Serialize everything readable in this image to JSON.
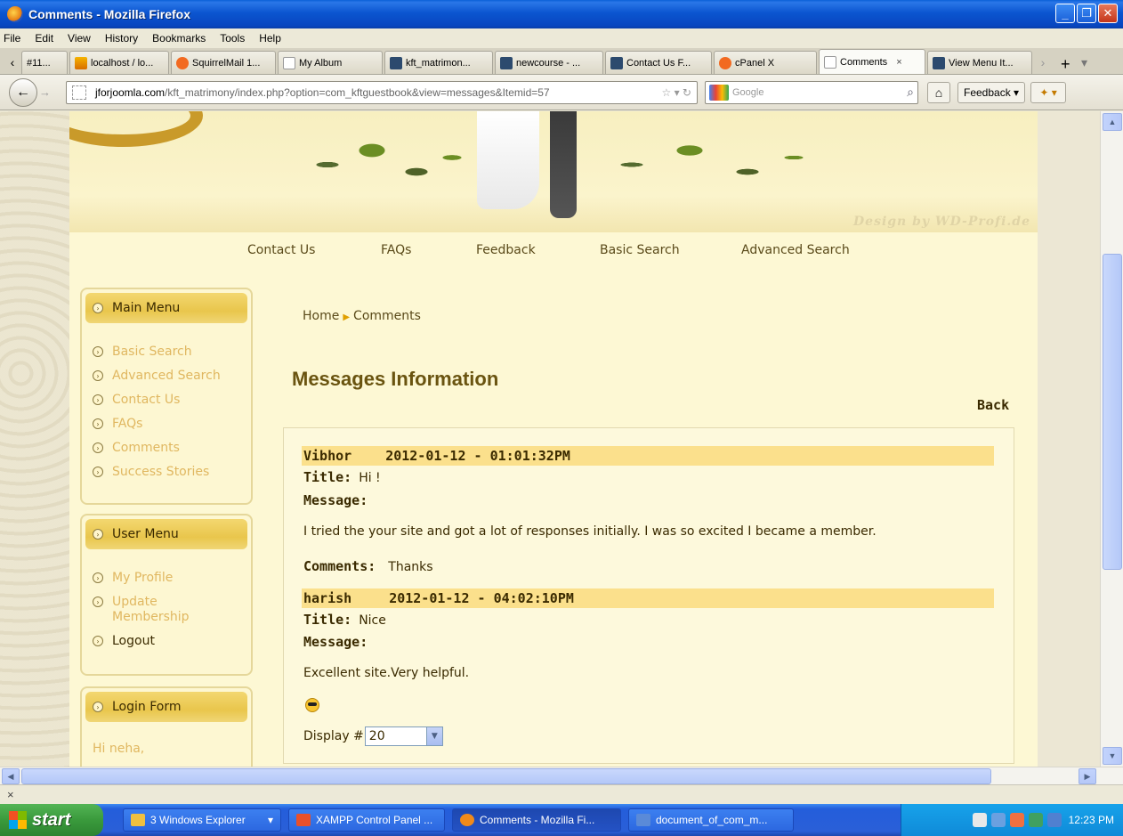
{
  "window": {
    "title": "Comments - Mozilla Firefox",
    "buttons": [
      "_",
      "❐",
      "✕"
    ]
  },
  "menu": [
    "File",
    "Edit",
    "View",
    "History",
    "Bookmarks",
    "Tools",
    "Help"
  ],
  "tabs": [
    {
      "label": "#11...",
      "icon": ""
    },
    {
      "label": "localhost / lo...",
      "icon": "pma"
    },
    {
      "label": "SquirrelMail 1...",
      "icon": "cp"
    },
    {
      "label": "My Album",
      "icon": "blank"
    },
    {
      "label": "kft_matrimon...",
      "icon": "joom"
    },
    {
      "label": "newcourse - ...",
      "icon": "joom"
    },
    {
      "label": "Contact Us F...",
      "icon": "joom"
    },
    {
      "label": "cPanel X",
      "icon": "cp"
    },
    {
      "label": "Comments",
      "icon": "blank",
      "active": true
    },
    {
      "label": "View Menu It...",
      "icon": "joom"
    }
  ],
  "nav": {
    "url_domain": "jforjoomla.com",
    "url_path": "/kft_matrimony/index.php?option=com_kftguestbook&view=messages&Itemid=57",
    "search_placeholder": "Google",
    "feedback_label": "Feedback"
  },
  "site": {
    "designby": "Design by WD-Profi.de",
    "topnav": [
      "Contact Us",
      "FAQs",
      "Feedback",
      "Basic Search",
      "Advanced Search"
    ],
    "main_menu": {
      "title": "Main Menu",
      "items": [
        "Basic Search",
        "Advanced Search",
        "Contact Us",
        "FAQs",
        "Comments",
        "Success Stories"
      ]
    },
    "user_menu": {
      "title": "User Menu",
      "items": [
        "My Profile",
        "Update Membership",
        "Logout"
      ]
    },
    "login_form": {
      "title": "Login Form",
      "greeting": "Hi neha,"
    }
  },
  "main": {
    "breadcrumb": {
      "home": "Home",
      "current": "Comments"
    },
    "title": "Messages Information",
    "back": "Back",
    "messages": [
      {
        "author": "Vibhor",
        "date": "2012-01-12 - 01:01:32PM",
        "title_label": "Title:",
        "title": "Hi !",
        "message_label": "Message:",
        "message": "I tried the your site and got a lot of responses initially. I was so excited I became a member.",
        "comments_label": "Comments:",
        "comments": "Thanks"
      },
      {
        "author": "harish",
        "date": "2012-01-12 - 04:02:10PM",
        "title_label": "Title:",
        "title": "Nice",
        "message_label": "Message:",
        "message": "Excellent site.Very helpful."
      }
    ],
    "display_label": "Display #",
    "display_value": "20"
  },
  "statusbar": {
    "close": "×"
  },
  "taskbar": {
    "start": "start",
    "tasks": [
      {
        "label": "3 Windows Explorer",
        "color": "#f0c040"
      },
      {
        "label": "XAMPP Control Panel ...",
        "color": "#e8502a"
      },
      {
        "label": "Comments - Mozilla Fi...",
        "color": "#f08a1a",
        "active": true
      },
      {
        "label": "document_of_com_m...",
        "color": "#5a8ad8"
      }
    ],
    "clock": "12:23 PM"
  }
}
